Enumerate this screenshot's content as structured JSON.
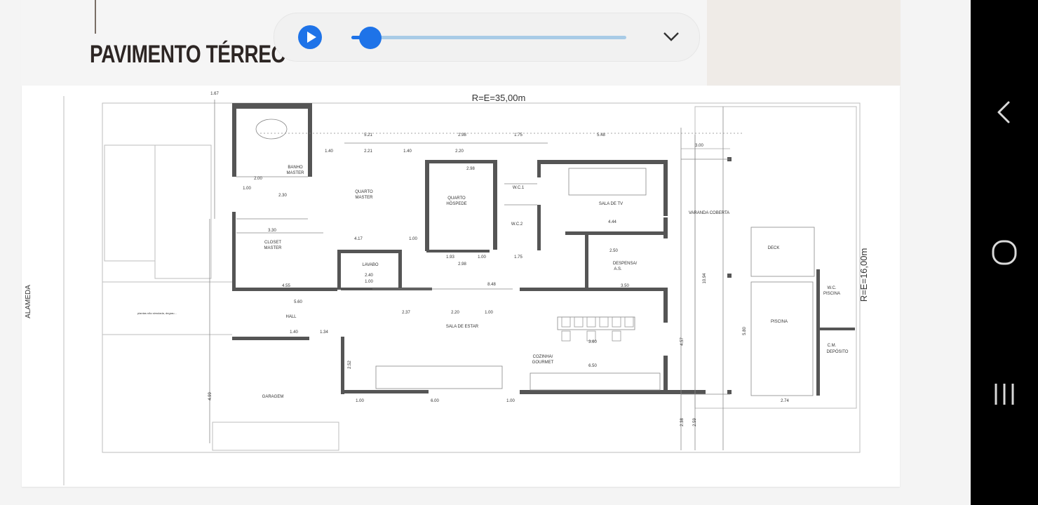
{
  "page": {
    "title": "PAVIMENTO TÉRREO"
  },
  "audio_player": {
    "progress": 0.07
  },
  "floor_plan": {
    "top_dimension": "R=E=35,00m",
    "side_dimension": "R=E=16,00m",
    "street_label": "ALAMEDA",
    "rooms": {
      "banho_master": [
        "BANHO",
        "MASTER"
      ],
      "quarto_master": [
        "QUARTO",
        "MASTER"
      ],
      "quarto_hospede": [
        "QUARTO",
        "HÓSPEDE"
      ],
      "wc1": "W.C.1",
      "wc2": "W.C.2",
      "sala_tv": "SALA DE TV",
      "varanda": "VARANDA COBERTA",
      "closet": [
        "CLOSET",
        "MASTER"
      ],
      "lavabo": "LAVABO",
      "despensa": [
        "DESPENSA/",
        "A.S."
      ],
      "deck": "DECK",
      "wc_piscina": [
        "W.C.",
        "PISCINA"
      ],
      "piscina": "PISCINA",
      "hall": "HALL",
      "sala_estar": "SALA DE ESTAR",
      "cozinha": [
        "COZINHA/",
        "GOURMET"
      ],
      "cm_deposito": [
        "C.M.",
        "DEPÓSITO"
      ],
      "garagem": "GARAGEM"
    },
    "dimensions": {
      "d_167": "1.67",
      "d_521": "5.21",
      "d_298a": "2.98",
      "d_175a": "1.75",
      "d_548": "5.48",
      "d_140a": "1.40",
      "d_221": "2.21",
      "d_140b": "1.40",
      "d_220a": "2.20",
      "d_298b": "2.98",
      "d_200a": "2.00",
      "d_100a": "1.00",
      "d_230": "2.30",
      "d_330": "3.30",
      "d_417": "4.17",
      "d_100b": "1.00",
      "d_444": "4.44",
      "d_250": "2.50",
      "d_193": "1.93",
      "d_100c": "1.00",
      "d_175b": "1.75",
      "d_298c": "2.98",
      "d_455": "4.55",
      "d_240": "2.40",
      "d_100d": "1.00",
      "d_848": "8.48",
      "d_350": "3.50",
      "d_560": "5.60",
      "d_237": "2.37",
      "d_220b": "2.20",
      "d_100e": "1.00",
      "d_140c": "1.40",
      "d_134": "1.34",
      "d_360": "3.60",
      "d_650": "6.50",
      "d_100f": "1.00",
      "d_600": "6.00",
      "d_100g": "1.00",
      "d_274": "2.74",
      "d_300": "3.00",
      "d_1094": "10.94",
      "d_580": "5.80",
      "d_457": "4.57",
      "d_252": "2.52",
      "d_499": "4.99",
      "d_238": "2.38",
      "d_259": "2.59"
    },
    "note": "plantas não simulada, degrau..."
  },
  "android_nav": {
    "icons": [
      "back-icon",
      "home-icon",
      "recents-icon"
    ]
  },
  "colors": {
    "accent_blue": "#1e73e8",
    "track_blue": "#a8cbe6",
    "wall": "#555555",
    "title": "#2d2624"
  }
}
